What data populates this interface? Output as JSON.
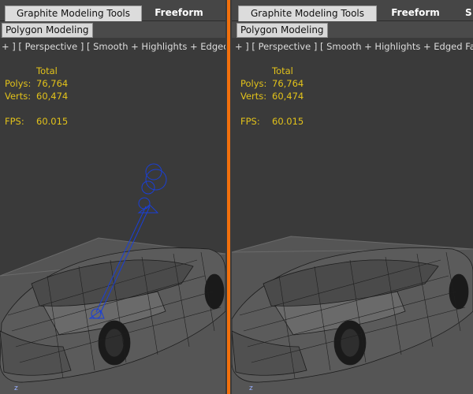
{
  "ribbon": {
    "tab_graphite": "Graphite Modeling Tools",
    "tab_freeform": "Freeform",
    "tab_selection_partial": "S",
    "sub_tab": "Polygon Modeling"
  },
  "viewport_label": "+ ] [ Perspective ] [ Smooth + Highlights + Edged Faces ]",
  "stats": {
    "total_header": "Total",
    "polys_label": "Polys:",
    "polys_value": "76,764",
    "verts_label": "Verts:",
    "verts_value": "60,474",
    "fps_label": "FPS:",
    "fps_value": "60.015"
  },
  "axis_label": "z",
  "colors": {
    "divider": "#f2700c",
    "stats_text": "#e2c21a",
    "bone_rig": "#1a3fd6",
    "grid_floor": "#5a5a5a"
  }
}
